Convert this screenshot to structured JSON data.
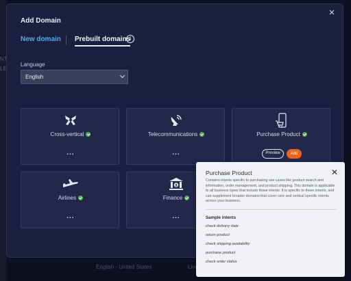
{
  "backdrop": {
    "left_fragment_top": "NT",
    "left_fragment_bottom": "LE",
    "footer_left": "English - United States",
    "footer_right": "Live"
  },
  "modal": {
    "title": "Add Domain",
    "tabs": [
      "New domain",
      "Prebuilt domains"
    ],
    "language_label": "Language",
    "language_value": "English",
    "cards": [
      {
        "name": "Cross-vertical",
        "icon": "bow-ribbon-icon",
        "more": "..."
      },
      {
        "name": "Telecommunications",
        "icon": "satellite-dish-icon",
        "more": "..."
      },
      {
        "name": "Purchase Product",
        "icon": "mobile-cart-icon",
        "preview": "Preview",
        "add": "Add"
      },
      {
        "name": "Airlines",
        "icon": "airplane-icon",
        "more": "..."
      },
      {
        "name": "Finance",
        "icon": "bank-icon",
        "more": "..."
      }
    ]
  },
  "popover": {
    "title": "Purchase Product",
    "description": "Contains intents specific to purchasing use cases like product search and information, order management, and product shipping. This domain is applicable to all business types that include those intents. It is specific to those intents, and can supplement broader domains that cover core and vertical specific intents across your business.",
    "subtitle": "Sample intents",
    "intents": [
      "check delivery date",
      "return product",
      "check shipping availability",
      "purchase product",
      "check order status"
    ]
  },
  "colors": {
    "accent": "#3fb1f0",
    "add": "#e8651e",
    "check": "#4cae4f"
  }
}
